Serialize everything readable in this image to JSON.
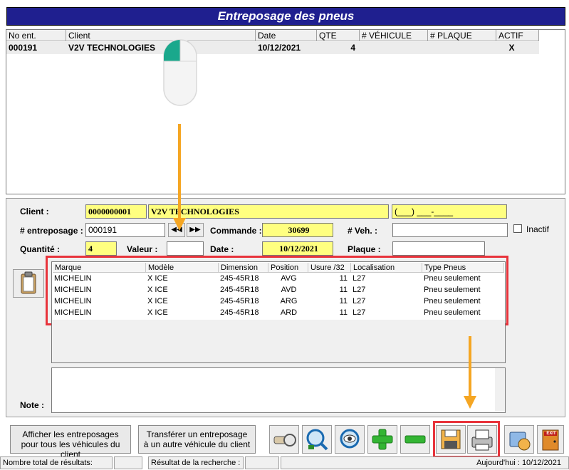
{
  "window": {
    "title": "Entreposage des pneus"
  },
  "results_grid": {
    "columns": [
      "No ent.",
      "Client",
      "Date",
      "QTE",
      "# VÉHICULE",
      "# PLAQUE",
      "ACTIF"
    ],
    "rows": [
      {
        "no_ent": "000191",
        "client": "V2V TECHNOLOGIES",
        "date": "10/12/2021",
        "qte": "4",
        "vehicule": "",
        "plaque": "",
        "actif": "X"
      }
    ]
  },
  "form": {
    "client_label": "Client :",
    "client_code": "0000000001",
    "client_name": "V2V TECHNOLOGIES",
    "client_phone": "(___) ___-____",
    "entreposage_label": "# entreposage :",
    "entreposage_value": "000191",
    "commande_label": "Commande :",
    "commande_value": "30699",
    "veh_label": "# Veh. :",
    "veh_value": "",
    "inactif_label": "Inactif",
    "quantite_label": "Quantité :",
    "quantite_value": "4",
    "valeur_label": "Valeur :",
    "valeur_value": "",
    "date_label": "Date :",
    "date_value": "10/12/2021",
    "plaque_label": "Plaque :",
    "plaque_value": "",
    "note_label": "Note :"
  },
  "tires": {
    "columns": [
      "Marque",
      "Modèle",
      "Dimension",
      "Position",
      "Usure /32",
      "Localisation",
      "Type Pneus"
    ],
    "rows": [
      {
        "marque": "MICHELIN",
        "modele": "X ICE",
        "dimension": "245-45R18",
        "position": "AVG",
        "usure": "11",
        "localisation": "L27",
        "type": "Pneu seulement"
      },
      {
        "marque": "MICHELIN",
        "modele": "X ICE",
        "dimension": "245-45R18",
        "position": "AVD",
        "usure": "11",
        "localisation": "L27",
        "type": "Pneu seulement"
      },
      {
        "marque": "MICHELIN",
        "modele": "X ICE",
        "dimension": "245-45R18",
        "position": "ARG",
        "usure": "11",
        "localisation": "L27",
        "type": "Pneu seulement"
      },
      {
        "marque": "MICHELIN",
        "modele": "X ICE",
        "dimension": "245-45R18",
        "position": "ARD",
        "usure": "11",
        "localisation": "L27",
        "type": "Pneu seulement"
      }
    ]
  },
  "buttons": {
    "afficher": "Afficher les entreposages pour tous les véhicules du client",
    "transferer": "Transférer un entreposage à un autre véhicule du client",
    "exit": "EXIT"
  },
  "status": {
    "total": "Nombre total de résultats:",
    "recherche": "Résultat de la recherche :",
    "aujourdhui": "Aujourd'hui : 10/12/2021"
  },
  "colors": {
    "title_bar": "#1f1f8f",
    "highlight": "#e8333b",
    "arrow": "#f5a623",
    "yellow_field": "#ffff80"
  }
}
